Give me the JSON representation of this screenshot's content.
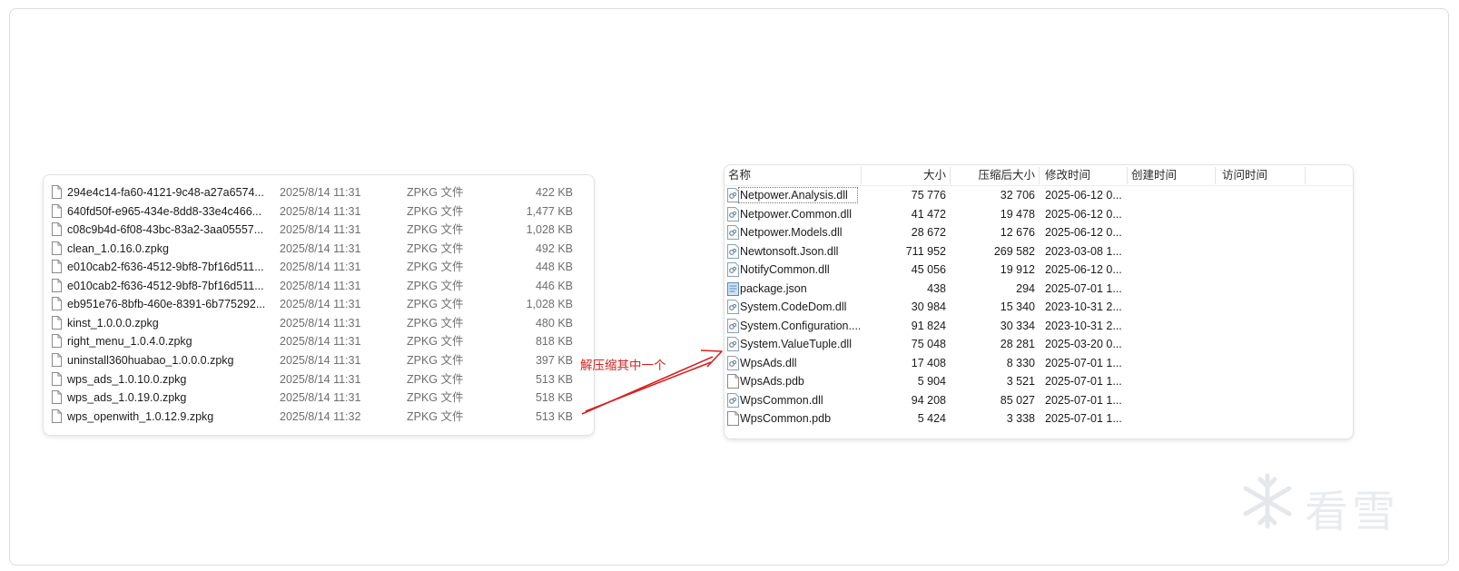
{
  "left_panel": {
    "files": [
      {
        "name": "294e4c14-fa60-4121-9c48-a27a6574...",
        "date": "2025/8/14 11:31",
        "type": "ZPKG 文件",
        "size": "422 KB"
      },
      {
        "name": "640fd50f-e965-434e-8dd8-33e4c466...",
        "date": "2025/8/14 11:31",
        "type": "ZPKG 文件",
        "size": "1,477 KB"
      },
      {
        "name": "c08c9b4d-6f08-43bc-83a2-3aa05557...",
        "date": "2025/8/14 11:31",
        "type": "ZPKG 文件",
        "size": "1,028 KB"
      },
      {
        "name": "clean_1.0.16.0.zpkg",
        "date": "2025/8/14 11:31",
        "type": "ZPKG 文件",
        "size": "492 KB"
      },
      {
        "name": "e010cab2-f636-4512-9bf8-7bf16d511...",
        "date": "2025/8/14 11:31",
        "type": "ZPKG 文件",
        "size": "448 KB"
      },
      {
        "name": "e010cab2-f636-4512-9bf8-7bf16d511...",
        "date": "2025/8/14 11:31",
        "type": "ZPKG 文件",
        "size": "446 KB"
      },
      {
        "name": "eb951e76-8bfb-460e-8391-6b775292...",
        "date": "2025/8/14 11:31",
        "type": "ZPKG 文件",
        "size": "1,028 KB"
      },
      {
        "name": "kinst_1.0.0.0.zpkg",
        "date": "2025/8/14 11:31",
        "type": "ZPKG 文件",
        "size": "480 KB"
      },
      {
        "name": "right_menu_1.0.4.0.zpkg",
        "date": "2025/8/14 11:31",
        "type": "ZPKG 文件",
        "size": "818 KB"
      },
      {
        "name": "uninstall360huabao_1.0.0.0.zpkg",
        "date": "2025/8/14 11:31",
        "type": "ZPKG 文件",
        "size": "397 KB"
      },
      {
        "name": "wps_ads_1.0.10.0.zpkg",
        "date": "2025/8/14 11:31",
        "type": "ZPKG 文件",
        "size": "513 KB"
      },
      {
        "name": "wps_ads_1.0.19.0.zpkg",
        "date": "2025/8/14 11:31",
        "type": "ZPKG 文件",
        "size": "518 KB"
      },
      {
        "name": "wps_openwith_1.0.12.9.zpkg",
        "date": "2025/8/14 11:32",
        "type": "ZPKG 文件",
        "size": "513 KB"
      }
    ]
  },
  "annotation": {
    "text": "解压缩其中一个",
    "color": "#d6201f"
  },
  "right_panel": {
    "columns": {
      "name": "名称",
      "size": "大小",
      "packed": "压缩后大小",
      "modified": "修改时间",
      "created": "创建时间",
      "accessed": "访问时间"
    },
    "files": [
      {
        "name": "Netpower.Analysis.dll",
        "size": "75 776",
        "packed": "32 706",
        "modified": "2025-06-12 0...",
        "icon": "dll-icon",
        "selected": true
      },
      {
        "name": "Netpower.Common.dll",
        "size": "41 472",
        "packed": "19 478",
        "modified": "2025-06-12 0...",
        "icon": "dll-icon"
      },
      {
        "name": "Netpower.Models.dll",
        "size": "28 672",
        "packed": "12 676",
        "modified": "2025-06-12 0...",
        "icon": "dll-icon"
      },
      {
        "name": "Newtonsoft.Json.dll",
        "size": "711 952",
        "packed": "269 582",
        "modified": "2023-03-08 1...",
        "icon": "dll-icon"
      },
      {
        "name": "NotifyCommon.dll",
        "size": "45 056",
        "packed": "19 912",
        "modified": "2025-06-12 0...",
        "icon": "dll-icon"
      },
      {
        "name": "package.json",
        "size": "438",
        "packed": "294",
        "modified": "2025-07-01 1...",
        "icon": "json-icon"
      },
      {
        "name": "System.CodeDom.dll",
        "size": "30 984",
        "packed": "15 340",
        "modified": "2023-10-31 2...",
        "icon": "dll-icon"
      },
      {
        "name": "System.Configuration....",
        "size": "91 824",
        "packed": "30 334",
        "modified": "2023-10-31 2...",
        "icon": "dll-icon"
      },
      {
        "name": "System.ValueTuple.dll",
        "size": "75 048",
        "packed": "28 281",
        "modified": "2025-03-20 0...",
        "icon": "dll-icon"
      },
      {
        "name": "WpsAds.dll",
        "size": "17 408",
        "packed": "8 330",
        "modified": "2025-07-01 1...",
        "icon": "dll-icon"
      },
      {
        "name": "WpsAds.pdb",
        "size": "5 904",
        "packed": "3 521",
        "modified": "2025-07-01 1...",
        "icon": "file-icon"
      },
      {
        "name": "WpsCommon.dll",
        "size": "94 208",
        "packed": "85 027",
        "modified": "2025-07-01 1...",
        "icon": "dll-icon"
      },
      {
        "name": "WpsCommon.pdb",
        "size": "5 424",
        "packed": "3 338",
        "modified": "2025-07-01 1...",
        "icon": "file-icon"
      }
    ]
  },
  "watermark": {
    "text": "看雪",
    "icon": "snowflake-icon"
  }
}
